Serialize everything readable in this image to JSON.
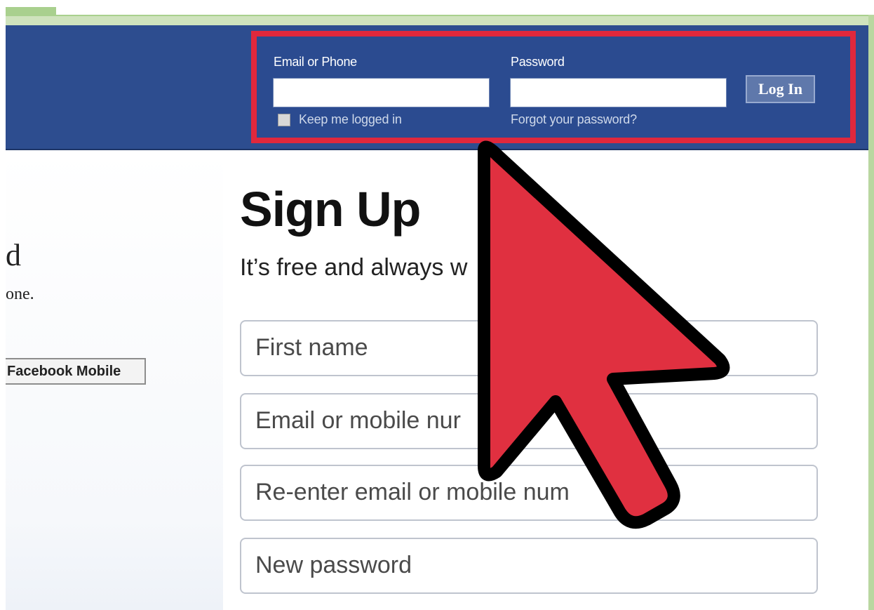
{
  "login": {
    "email_label": "Email or Phone",
    "password_label": "Password",
    "email_value": "",
    "password_value": "",
    "keep_logged_in": "Keep me logged in",
    "forgot_password": "Forgot your password?",
    "login_button": "Log In"
  },
  "left": {
    "line1": "d",
    "line2": "one.",
    "mobile_button": "Facebook Mobile"
  },
  "signup": {
    "title": "Sign Up",
    "subtitle": "It’s free and always w",
    "fields": [
      {
        "placeholder": "First name"
      },
      {
        "placeholder": "Email or mobile nur"
      },
      {
        "placeholder": "Re-enter email or mobile num"
      },
      {
        "placeholder": "New password"
      }
    ]
  },
  "colors": {
    "facebook_blue": "#2d4d8f",
    "highlight_red": "#e0283c",
    "arrow_red": "#e03040"
  },
  "icons": {
    "cursor": "red-arrow-cursor-icon"
  }
}
